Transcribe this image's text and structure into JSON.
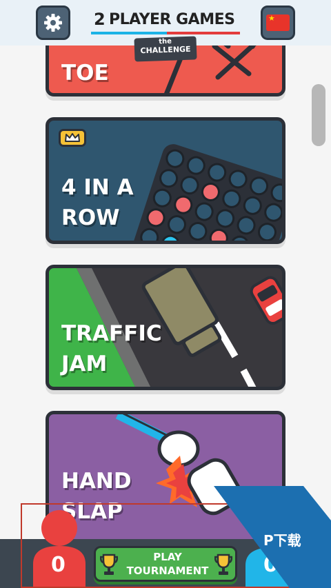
{
  "header": {
    "logo_number": "2",
    "logo_text": "PLAYER GAMES",
    "badge_the": "the",
    "badge_challenge": "CHALLENGE",
    "settings_icon": "gear-icon",
    "language_icon": "china-flag-icon"
  },
  "games": [
    {
      "title_line1": "TOE",
      "color": "#ee5a4f"
    },
    {
      "title_line1": "4 IN A",
      "title_line2": "ROW",
      "color": "#2f566f",
      "premium": true,
      "badge_icon": "crown-icon"
    },
    {
      "title_line1": "TRAFFIC",
      "title_line2": "JAM",
      "color": "#39383d"
    },
    {
      "title_line1": "HAND",
      "title_line2": "SLAP",
      "color": "#8b5fa3"
    }
  ],
  "bottom": {
    "player_red_score": "0",
    "player_blue_score": "0",
    "play_line1": "PLAY",
    "play_line2": "TOURNAMENT",
    "red_color": "#e9413f",
    "blue_color": "#21b5e8"
  },
  "watermark": {
    "text": "P下载"
  }
}
